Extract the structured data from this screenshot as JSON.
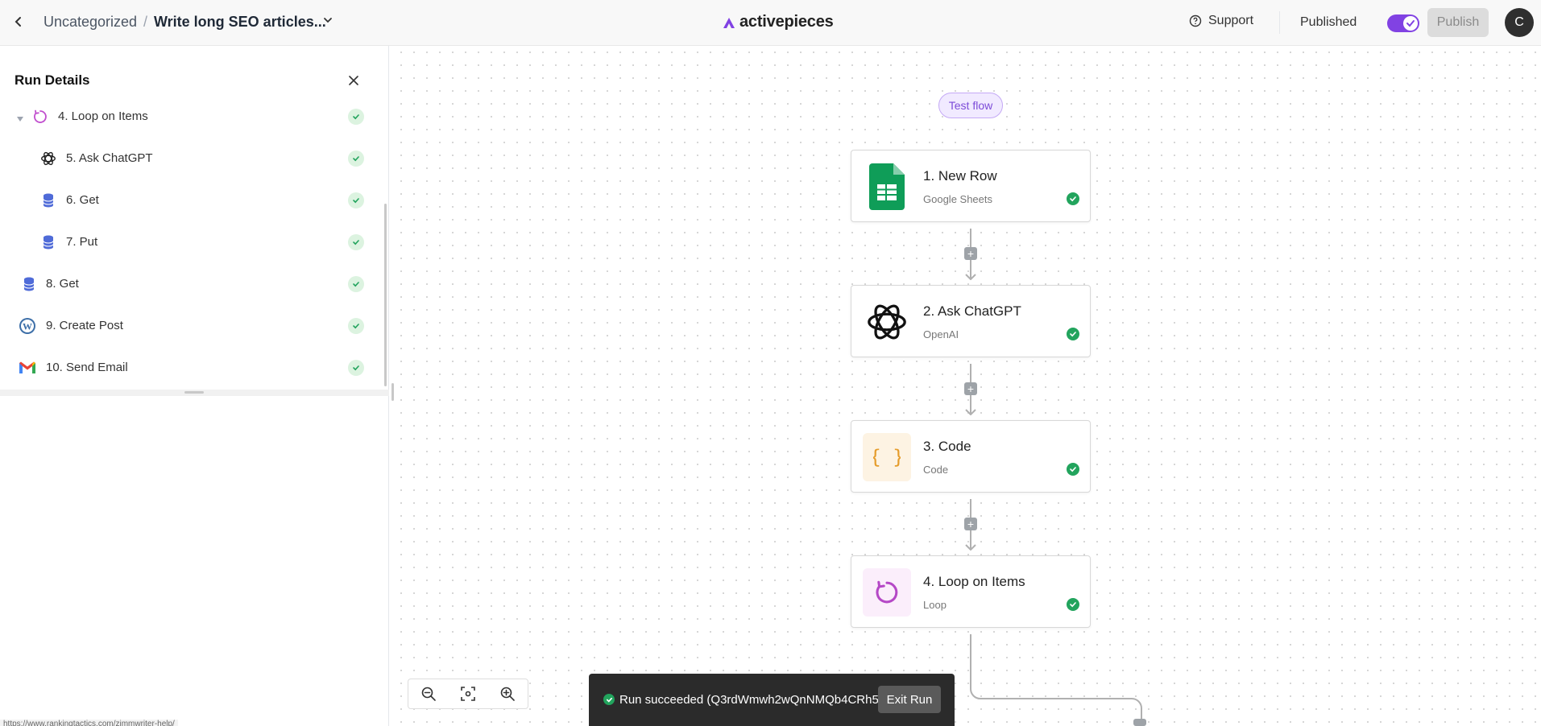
{
  "header": {
    "breadcrumb_folder": "Uncategorized",
    "breadcrumb_separator": "/",
    "flow_name": "Write long SEO articles...",
    "logo_text": "activepieces",
    "support_label": "Support",
    "status_label": "Published",
    "publish_label": "Publish",
    "avatar_initial": "C",
    "toggle_on": true
  },
  "run_panel": {
    "title": "Run Details",
    "steps": [
      {
        "label": "4. Loop on Items",
        "icon": "loop-icon",
        "status": "success"
      },
      {
        "label": "5. Ask ChatGPT",
        "icon": "openai-icon",
        "status": "success"
      },
      {
        "label": "6. Get",
        "icon": "storage-icon",
        "status": "success"
      },
      {
        "label": "7. Put",
        "icon": "storage-icon",
        "status": "success"
      },
      {
        "label": "8. Get",
        "icon": "storage-icon",
        "status": "success"
      },
      {
        "label": "9. Create Post",
        "icon": "wordpress-icon",
        "status": "success"
      },
      {
        "label": "10. Send Email",
        "icon": "gmail-icon",
        "status": "success"
      }
    ]
  },
  "status_url": "https://www.rankingtactics.com/zimmwriter-help/",
  "canvas": {
    "test_flow_label": "Test flow",
    "nodes": [
      {
        "title": "1. New Row",
        "subtitle": "Google Sheets",
        "icon": "google-sheets-icon"
      },
      {
        "title": "2. Ask ChatGPT",
        "subtitle": "OpenAI",
        "icon": "openai-icon"
      },
      {
        "title": "3. Code",
        "subtitle": "Code",
        "icon": "code-icon"
      },
      {
        "title": "4. Loop on Items",
        "subtitle": "Loop",
        "icon": "loop-icon"
      }
    ]
  },
  "toast": {
    "message": "Run succeeded (Q3rdWmwh2wQnNMQb4CRh5)",
    "exit_label": "Exit Run"
  },
  "colors": {
    "accent": "#8142e3",
    "success": "#22a45d"
  }
}
